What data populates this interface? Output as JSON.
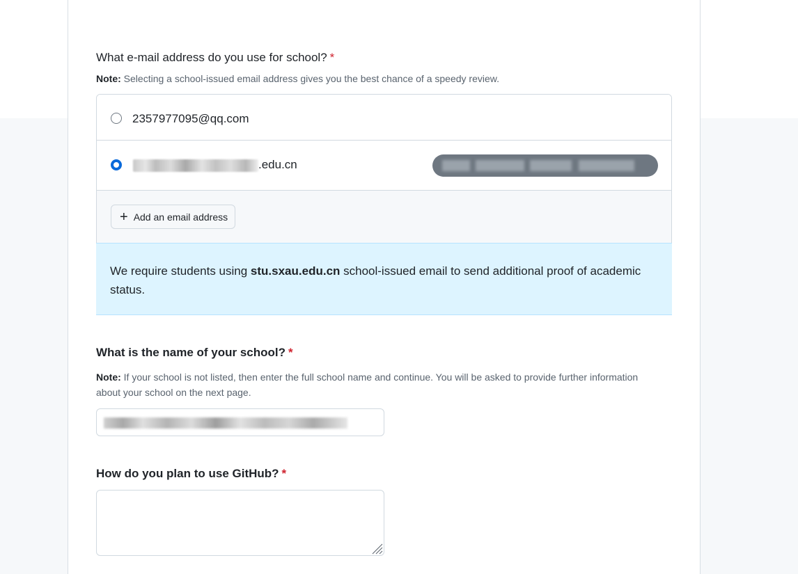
{
  "email_question": {
    "label": "What e-mail address do you use for school?",
    "required_mark": "*",
    "note_bold": "Note:",
    "note_text": " Selecting a school-issued email address gives you the best chance of a speedy review.",
    "options": [
      {
        "address": "2357977095@qq.com",
        "selected": false
      },
      {
        "address": ".edu.cn",
        "selected": true
      }
    ],
    "add_button_icon": "plus-icon",
    "add_button_label": "Add an email address"
  },
  "flash": {
    "prefix": "We require students using ",
    "domain": "stu.sxau.edu.cn",
    "suffix": " school-issued email to send additional proof of academic status."
  },
  "school_question": {
    "label": "What is the name of your school?",
    "required_mark": "*",
    "note_bold": "Note:",
    "note_text": " If your school is not listed, then enter the full school name and continue. You will be asked to provide further information about your school on the next page."
  },
  "plan_question": {
    "label": "How do you plan to use GitHub?",
    "required_mark": "*",
    "value": ""
  },
  "colors": {
    "accent": "#0969da",
    "required": "#cf222e",
    "flash_bg": "#ddf4ff",
    "border": "#d1d9e0"
  }
}
